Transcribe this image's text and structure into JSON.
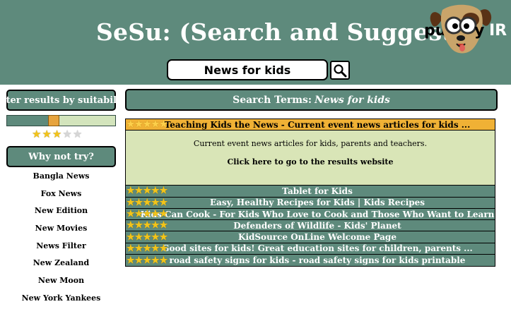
{
  "header": {
    "title": "SeSu: (Search and Suggest)",
    "logo": {
      "part1": "pu",
      "part2": "y",
      "part3": "IR"
    }
  },
  "search": {
    "value": "News for kids"
  },
  "sidebar": {
    "filter_label": "Filter results by suitability",
    "slider_level": 0.42,
    "rating": {
      "filled": 3,
      "total": 5
    },
    "why_not_label": "Why not try?",
    "suggestions": [
      "Bangla News",
      "Fox News",
      "New Edition",
      "New Movies",
      "News Filter",
      "New Zealand",
      "New Moon",
      "New York Yankees"
    ]
  },
  "main": {
    "search_terms_label": "Search Terms:",
    "search_terms_value": "News for kids",
    "results": [
      {
        "title": "Teaching Kids the News - Current event news articles for kids ...",
        "stars": 5,
        "active": true
      },
      {
        "title": "Tablet for Kids",
        "stars": 5
      },
      {
        "title": "Easy, Healthy Recipes for Kids | Kids Recipes",
        "stars": 5
      },
      {
        "title": "Kids Can Cook - For Kids Who Love to Cook and Those Who Want to Learn",
        "stars": 5
      },
      {
        "title": "Defenders of Wildlife - Kids' Planet",
        "stars": 5
      },
      {
        "title": "KidSource OnLine Welcome Page",
        "stars": 5
      },
      {
        "title": "Good sites for kids! Great education sites for children, parents ...",
        "stars": 5
      },
      {
        "title": "road safety signs for kids - road safety signs for kids printable",
        "stars": 5
      }
    ],
    "preview": {
      "description": "Current event news articles for kids, parents and teachers.",
      "link_text": "Click here to go to the results website"
    }
  },
  "colors": {
    "header_green": "#5e8a7c",
    "active_orange": "#f0b135",
    "preview_bg": "#d9e5b7",
    "star_gold": "#f3c419"
  }
}
